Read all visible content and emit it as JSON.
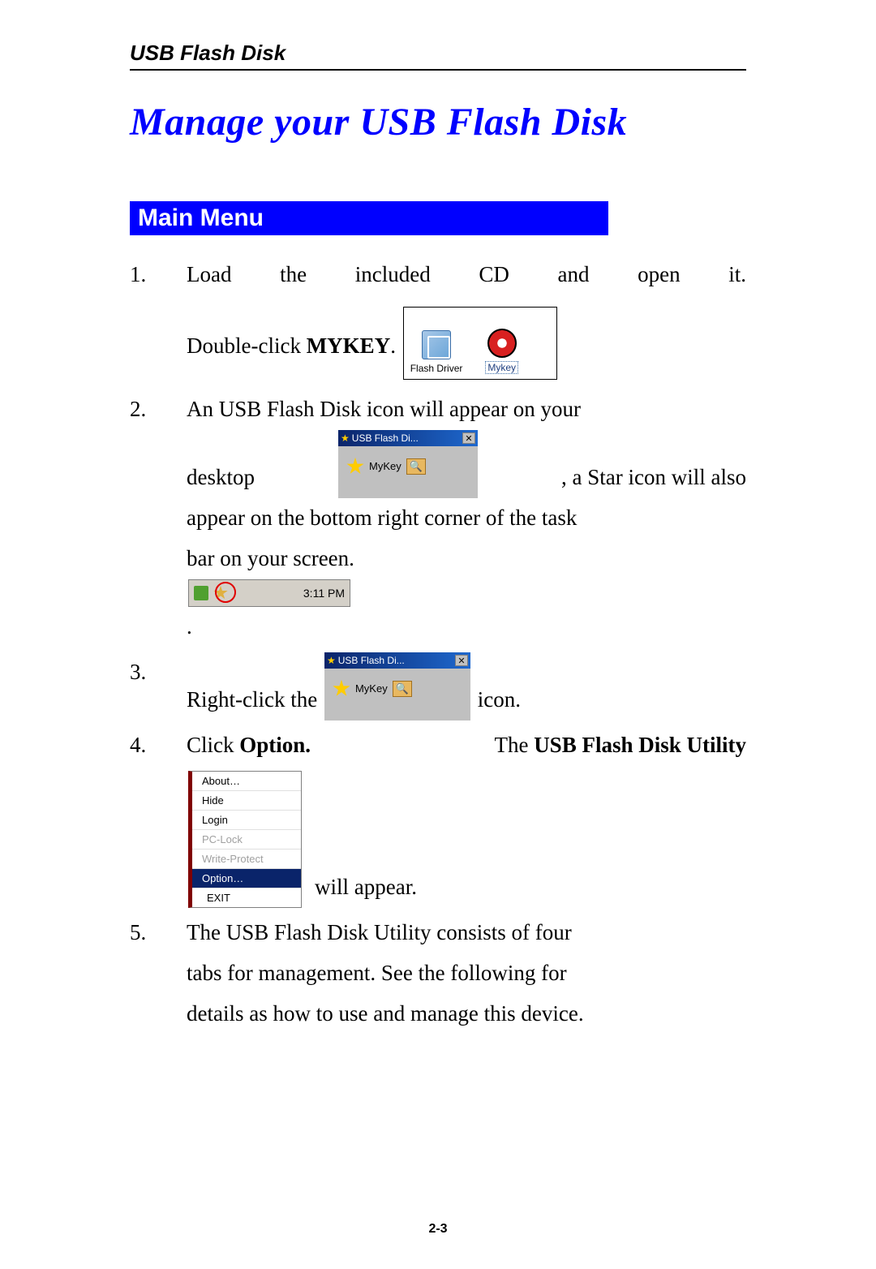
{
  "header": "USB Flash Disk",
  "title": "Manage your USB Flash Disk",
  "section_heading": "Main Menu",
  "steps": {
    "s1a_words": [
      "Load",
      "the",
      "included",
      "CD",
      "and",
      "open",
      "it."
    ],
    "s1b_pre": "Double-click ",
    "s1b_bold": "MYKEY",
    "s1b_post": ".",
    "s2a": "An USB Flash Disk icon will appear on your",
    "s2b_pre": "desktop",
    "s2b_post": ",  a  Star  icon  will  also",
    "s2c": "appear on the bottom right corner of the task",
    "s2d_pre": "bar on your screen. ",
    "s2d_post": " .",
    "s3_pre": "Right-click the ",
    "s3_post": "icon.",
    "s4a_pre": "Click ",
    "s4a_b1": "Option.",
    "s4a_mid": " The ",
    "s4a_b2": "USB Flash Disk Utility",
    "s4b": "will appear.",
    "s5a": "The USB Flash Disk Utility consists of four",
    "s5b": "tabs for management. See the following for",
    "s5c": "details as how to use and manage this device."
  },
  "cd": {
    "label1": "Flash Driver",
    "label2": "Mykey"
  },
  "desktop": {
    "title": "USB Flash Di...",
    "item": "MyKey"
  },
  "tray": {
    "time": "3:11 PM"
  },
  "menu": {
    "about": "About…",
    "hide": "Hide",
    "login": "Login",
    "pclock": "PC-Lock",
    "write": "Write-Protect",
    "option": "Option…",
    "exit": "EXIT"
  },
  "page_num": "2-3"
}
